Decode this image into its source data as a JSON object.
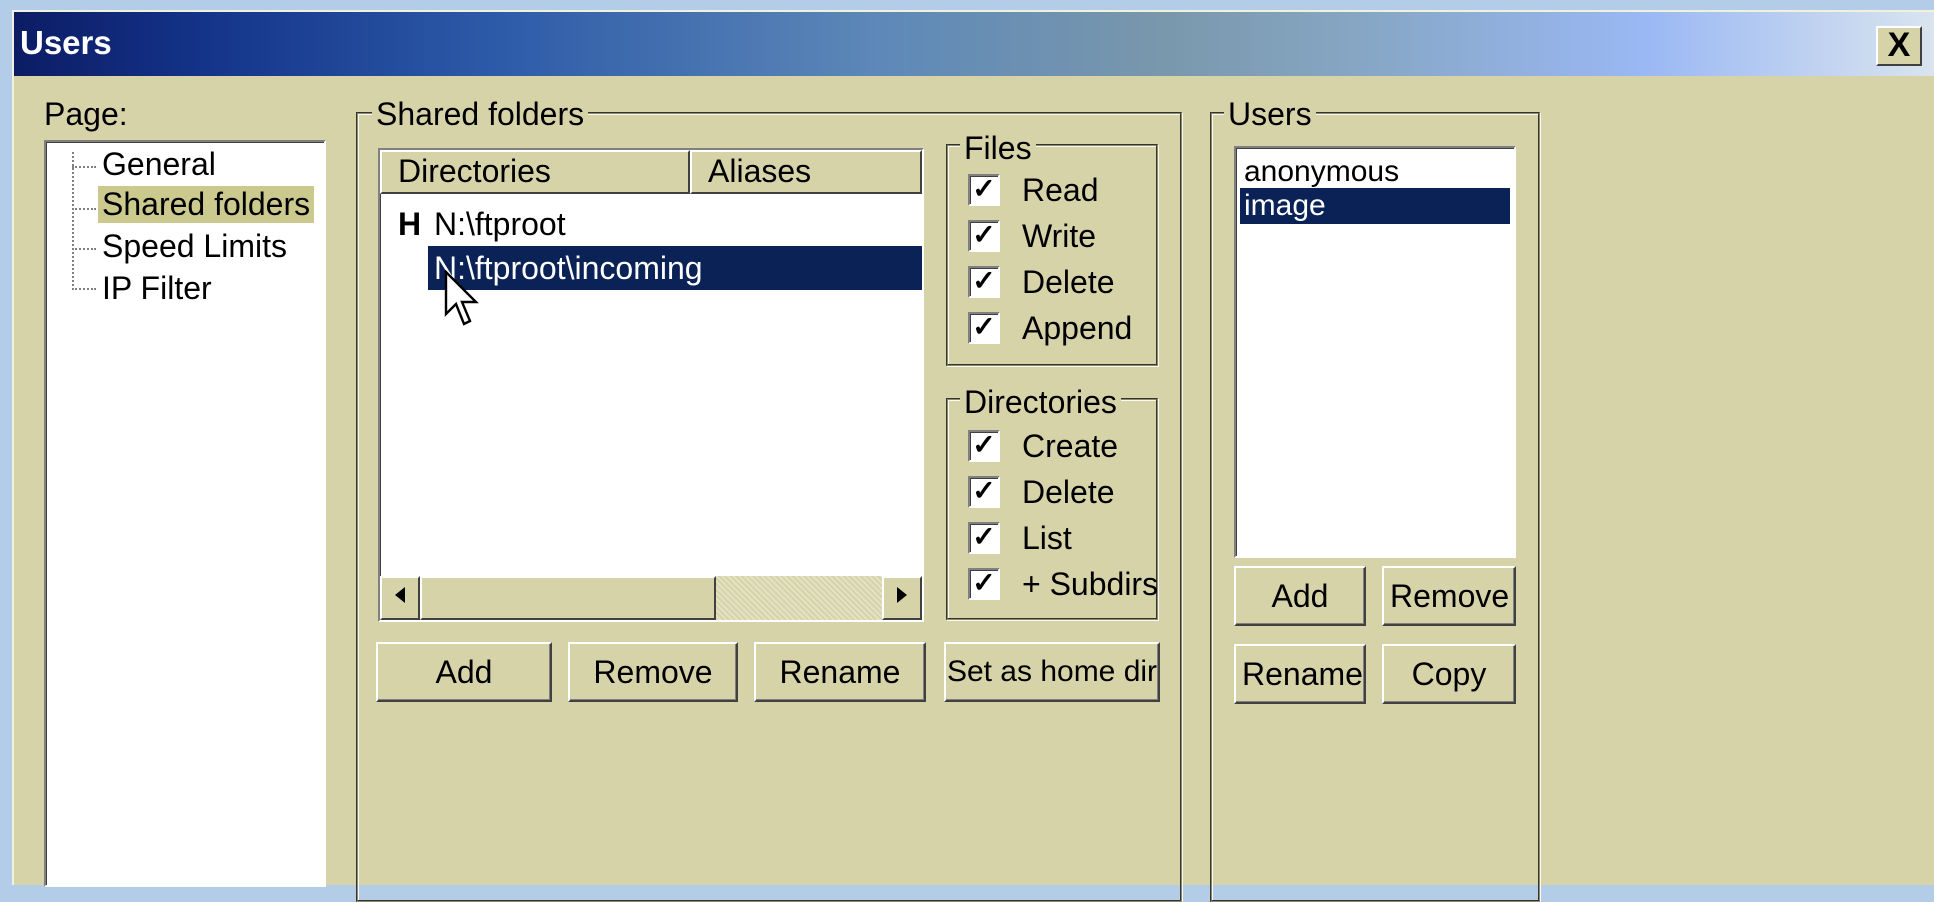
{
  "dialog": {
    "title": "Users",
    "close_glyph": "X"
  },
  "page_panel": {
    "label": "Page:",
    "items": [
      {
        "label": "General",
        "selected": false
      },
      {
        "label": "Shared folders",
        "selected": true
      },
      {
        "label": "Speed Limits",
        "selected": false
      },
      {
        "label": "IP Filter",
        "selected": false
      }
    ]
  },
  "shared_folders": {
    "legend": "Shared folders",
    "columns": [
      "Directories",
      "Aliases"
    ],
    "rows": [
      {
        "marker": "H",
        "path": "N:\\ftproot",
        "selected": false
      },
      {
        "marker": "",
        "path": "N:\\ftproot\\incoming",
        "selected": true
      }
    ],
    "buttons": {
      "add": "Add",
      "remove": "Remove",
      "rename": "Rename",
      "set_home": "Set as home dir"
    }
  },
  "files": {
    "legend": "Files",
    "items": [
      {
        "label": "Read",
        "checked": true
      },
      {
        "label": "Write",
        "checked": true
      },
      {
        "label": "Delete",
        "checked": true
      },
      {
        "label": "Append",
        "checked": true
      }
    ]
  },
  "directories": {
    "legend": "Directories",
    "items": [
      {
        "label": "Create",
        "checked": true
      },
      {
        "label": "Delete",
        "checked": true
      },
      {
        "label": "List",
        "checked": true
      },
      {
        "label": "+ Subdirs",
        "checked": true
      }
    ]
  },
  "users": {
    "legend": "Users",
    "list": [
      {
        "label": "anonymous",
        "selected": false
      },
      {
        "label": "image",
        "selected": true
      }
    ],
    "buttons": {
      "add": "Add",
      "remove": "Remove",
      "rename": "Rename",
      "copy": "Copy"
    }
  },
  "icons": {
    "close": "close-icon",
    "scroll_left": "arrow-left-icon",
    "scroll_right": "arrow-right-icon",
    "check": "check-icon",
    "cursor": "mouse-pointer-icon"
  },
  "colors": {
    "dialog_bg": "#d6d3a9",
    "selection": "#0a2255",
    "tree_selection": "#cbc98e",
    "title_start": "#0c1c64",
    "desktop": "#b3cde8"
  }
}
